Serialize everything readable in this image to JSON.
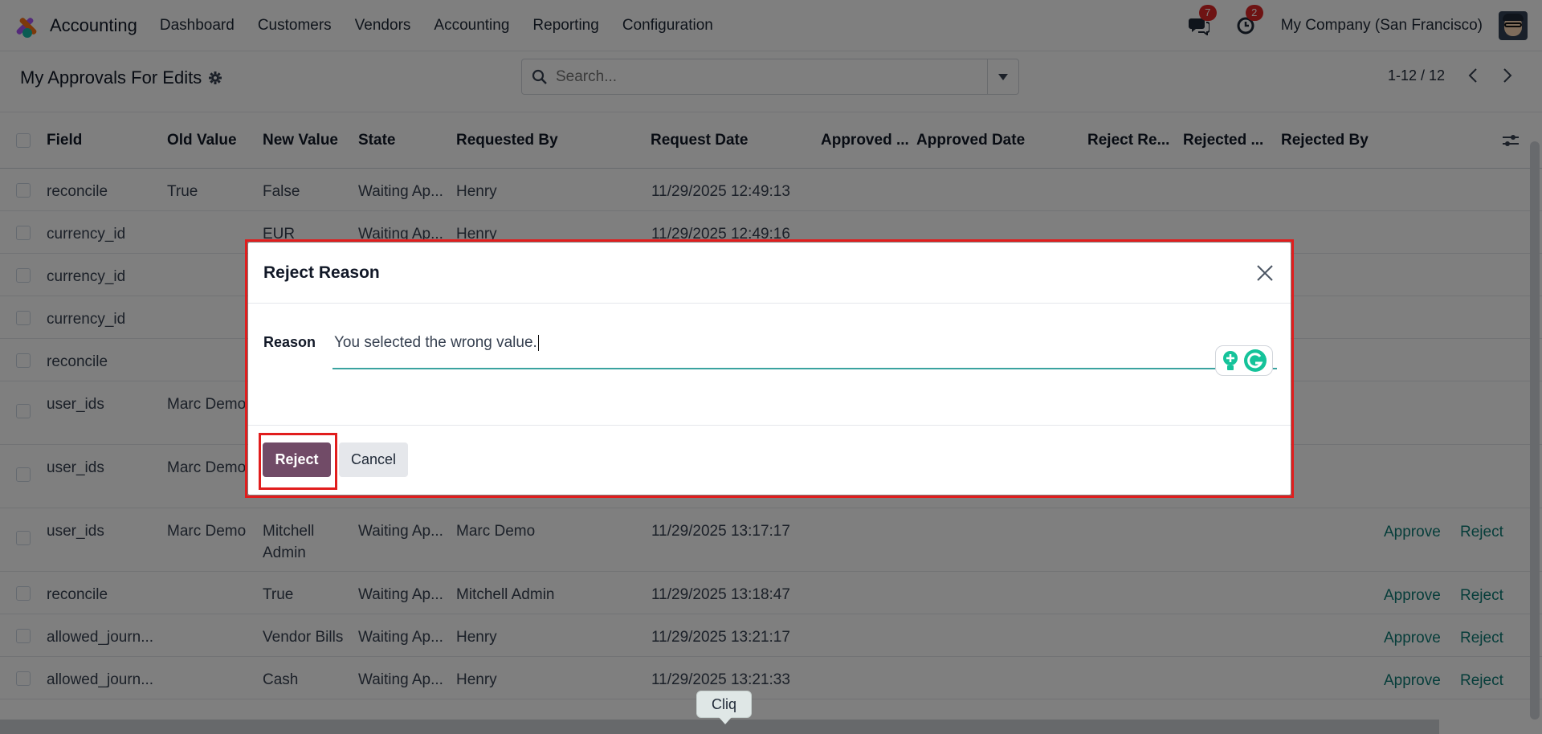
{
  "navbar": {
    "app_name": "Accounting",
    "menu": [
      "Dashboard",
      "Customers",
      "Vendors",
      "Accounting",
      "Reporting",
      "Configuration"
    ],
    "messages_count": "7",
    "activities_count": "2",
    "company": "My Company (San Francisco)"
  },
  "control": {
    "title": "My Approvals For Edits",
    "search_placeholder": "Search...",
    "pager": "1-12 / 12"
  },
  "table": {
    "headers": [
      "Field",
      "Old Value",
      "New Value",
      "State",
      "Requested By",
      "Request Date",
      "Approved ...",
      "Approved Date",
      "Reject Re...",
      "Rejected ...",
      "Rejected By"
    ],
    "rows": [
      {
        "field": "reconcile",
        "old": "True",
        "new": "False",
        "state": "Waiting Ap...",
        "by": "Henry",
        "date": "11/29/2025 12:49:13"
      },
      {
        "field": "currency_id",
        "old": "",
        "new": "EUR",
        "state": "Waiting Ap...",
        "by": "Henry",
        "date": "11/29/2025 12:49:16"
      },
      {
        "field": "currency_id",
        "old": "",
        "new": "",
        "state": "",
        "by": "",
        "date": ""
      },
      {
        "field": "currency_id",
        "old": "",
        "new": "",
        "state": "",
        "by": "",
        "date": ""
      },
      {
        "field": "reconcile",
        "old": "",
        "new": "",
        "state": "",
        "by": "",
        "date": ""
      },
      {
        "field": "user_ids",
        "old": "Marc Demo",
        "new": "",
        "state": "",
        "by": "",
        "date": ""
      },
      {
        "field": "user_ids",
        "old": "Marc Demo",
        "new": "",
        "state": "",
        "by": "",
        "date": ""
      },
      {
        "field": "user_ids",
        "old": "Marc Demo",
        "new": "Mitchell Admin",
        "state": "Waiting Ap...",
        "by": "Marc Demo",
        "date": "11/29/2025 13:17:17",
        "approve": "Approve",
        "reject": "Reject"
      },
      {
        "field": "reconcile",
        "old": "",
        "new": "True",
        "state": "Waiting Ap...",
        "by": "Mitchell Admin",
        "date": "11/29/2025 13:18:47",
        "approve": "Approve",
        "reject": "Reject"
      },
      {
        "field": "allowed_journ...",
        "old": "",
        "new": "Vendor Bills",
        "state": "Waiting Ap...",
        "by": "Henry",
        "date": "11/29/2025 13:21:17",
        "approve": "Approve",
        "reject": "Reject"
      },
      {
        "field": "allowed_journ...",
        "old": "",
        "new": "Cash",
        "state": "Waiting Ap...",
        "by": "Henry",
        "date": "11/29/2025 13:21:33",
        "approve": "Approve",
        "reject": "Reject"
      }
    ]
  },
  "modal": {
    "title": "Reject Reason",
    "reason_label": "Reason",
    "reason_value": "You selected the wrong value.",
    "reject_label": "Reject",
    "cancel_label": "Cancel"
  },
  "bottom": {
    "cliq_label": "Cliq"
  },
  "colors": {
    "brand": "#714b67",
    "link": "#0d7a74",
    "badge": "#dc2626",
    "highlight": "#e11d1d"
  }
}
